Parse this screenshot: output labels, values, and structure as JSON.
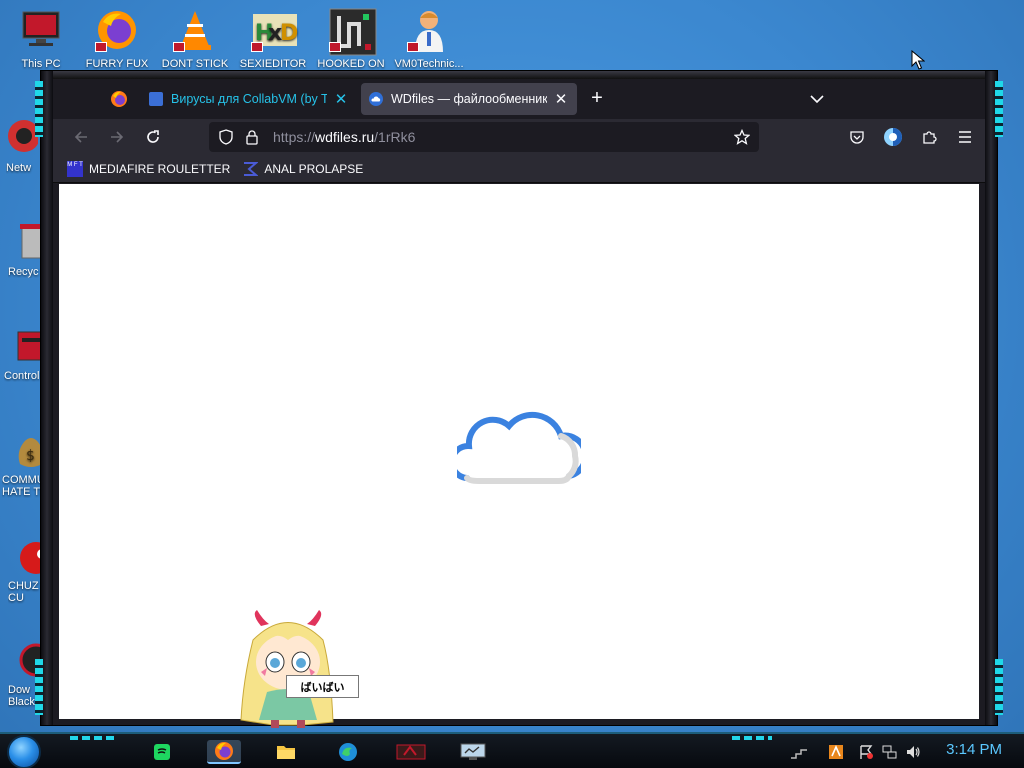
{
  "desktop": {
    "icons": [
      {
        "label": "This PC",
        "icon": "this-pc-icon"
      },
      {
        "label": "FURRY FUX",
        "icon": "firefox-icon"
      },
      {
        "label": "DONT STICK",
        "icon": "vlc-icon"
      },
      {
        "label": "SEXIEDITOR",
        "icon": "hex-editor-icon"
      },
      {
        "label": "HOOKED ON",
        "icon": "maze-app-icon"
      },
      {
        "label": "VM0Technic...",
        "icon": "technician-icon"
      },
      {
        "label": "Netw",
        "icon": "network-icon"
      },
      {
        "label": "Recyc",
        "icon": "recycle-bin-icon"
      },
      {
        "label": "Control",
        "icon": "control-panel-icon"
      },
      {
        "label": "COMMU HATE TH",
        "icon": "money-bag-icon"
      },
      {
        "label": "CHUZ CU",
        "icon": "red-creature-icon"
      },
      {
        "label": "Dow Black",
        "icon": "download-icon"
      }
    ]
  },
  "browser": {
    "tabs": [
      {
        "title": "Вирусы для CollabVM (by Test",
        "active": false,
        "favicon": "page-icon"
      },
      {
        "title": "WDfiles — файлообменник бе",
        "active": true,
        "favicon": "cloud-favicon"
      }
    ],
    "url": {
      "scheme": "https://",
      "host": "wdfiles.ru",
      "path": "/1rRk6"
    },
    "bookmarks": [
      {
        "label": "MEDIAFIRE ROULETTER",
        "icon": "mft-icon"
      },
      {
        "label": "ANAL PROLAPSE",
        "icon": "sigma-icon"
      }
    ]
  },
  "sticker": {
    "bubble_text": "ばいばい"
  },
  "taskbar": {
    "clock": "3:14 PM",
    "pinned": [
      "spotify-icon",
      "firefox-icon",
      "file-explorer-icon",
      "edge-icon",
      "vm-app-icon",
      "monitor-app-icon"
    ]
  },
  "colors": {
    "desktop_bg": "#3d8fd6",
    "browser_chrome": "#2b2a33",
    "tab_accent": "#26c2e8",
    "cloud_blue": "#3b82e0",
    "frame_neon": "#20d8e8",
    "clock": "#5bc8ff"
  }
}
